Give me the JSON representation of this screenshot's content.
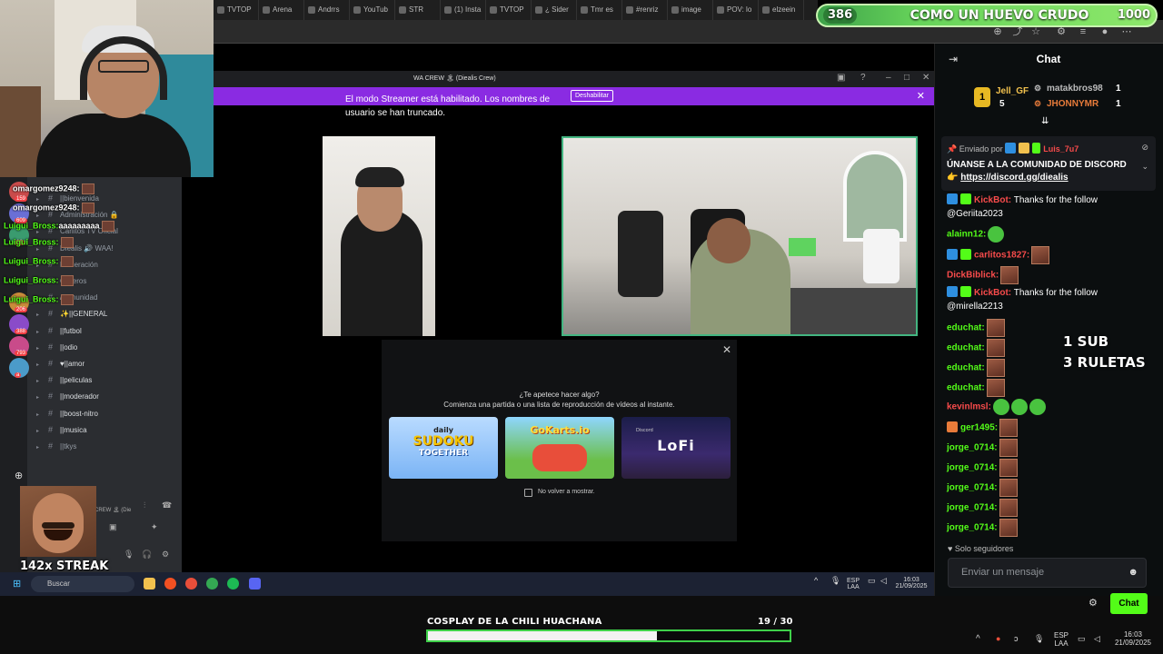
{
  "browser": {
    "tabs": [
      "TVTOP",
      "Arena",
      "Andrrs",
      "YouTub",
      "STR",
      "(1) Insta",
      "TVTOP",
      "¿ Sider",
      "Tmr es",
      "#renriz",
      "image",
      "POV: lo",
      "elzeein"
    ]
  },
  "goal": {
    "current": "386",
    "title": "COMO UN HUEVO CRUDO",
    "target": "1000"
  },
  "discord_overlay": {
    "chat_lines": [
      {
        "user": "omargomez9248:",
        "text": ""
      },
      {
        "user": "omargomez9248:",
        "text": ""
      },
      {
        "user": "Luigui_Bross:",
        "text": "aaaaaaaaa"
      },
      {
        "user": "Luigui_Bross:",
        "text": ""
      },
      {
        "user": "Luigui_Bross:",
        "text": ""
      },
      {
        "user": "Luigui_Bross:",
        "text": ""
      },
      {
        "user": "Luigui_Bross:",
        "text": ""
      }
    ],
    "channels": [
      {
        "label": "||bienvenida"
      },
      {
        "label": "Administración 🔒"
      },
      {
        "label": "Carlitos TV Oficial"
      },
      {
        "label": "Diealis 🔊 WAA!"
      },
      {
        "label": "Moderación"
      },
      {
        "label": "Cliperos"
      },
      {
        "label": "/comunidad"
      },
      {
        "label": "✨||GENERAL"
      },
      {
        "label": "||futbol"
      },
      {
        "label": "||odio"
      },
      {
        "label": "♥||amor"
      },
      {
        "label": "||peliculas"
      },
      {
        "label": "||moderador"
      },
      {
        "label": "||boost-nitro"
      },
      {
        "label": "||musica"
      },
      {
        "label": "||tkys"
      }
    ],
    "server_badges": [
      "159",
      "609",
      "66",
      "206",
      "388",
      "793",
      "a"
    ],
    "voice_label": "CREW 🏝 (Die",
    "streak": "142x STREAK"
  },
  "discord_window": {
    "title": "WA CREW 🏝 (Diealis Crew)",
    "streamer_notice": "El modo Streamer está habilitado. Los nombres de usuario se han truncado.",
    "disable_button": "Deshabilitar",
    "activity": {
      "heading": "¿Te apetece hacer algo?",
      "subheading": "Comienza una partida o una lista de reproducción de vídeos al instante.",
      "cards": [
        {
          "line1": "daily",
          "line2": "SUDOKU",
          "line3": "TOGETHER"
        },
        {
          "line1": "GoKarts.io"
        },
        {
          "line1": "LoFi",
          "sub": "Discord"
        }
      ],
      "checkbox_label": "No volver a mostrar."
    }
  },
  "taskbar_inner": {
    "search_placeholder": "Buscar",
    "lang": "ESP\nLAA",
    "time": "16:03",
    "date": "21/09/2025"
  },
  "bottom": {
    "title": "COSPLAY DE LA CHILI HUACHANA",
    "counter": "19  / 30",
    "progress_fraction": 0.633,
    "lang": "ESP\nLAA",
    "time": "16:03",
    "date": "21/09/2025"
  },
  "chat": {
    "title": "Chat",
    "top_gifters": [
      {
        "name": "Jell_GF",
        "count": "5"
      },
      {
        "name": "matakbros98",
        "count": "1"
      },
      {
        "name": "JHONNYMR",
        "count": "1"
      }
    ],
    "pinned": {
      "sent_by": "Enviado por",
      "user": "Luis_7u7",
      "body": "ÚNANSE A LA COMUNIDAD DE DISCORD 👉",
      "link": "https://discord.gg/diealis"
    },
    "messages": [
      {
        "user": "KickBot:",
        "color": "#f84b4b",
        "text": " Thanks for the follow @Geriita2023",
        "badges": 2
      },
      {
        "user": "alainn12:",
        "color": "#53fc18",
        "text": "",
        "badges": 0
      },
      {
        "user": "carlitos1827:",
        "color": "#f84b4b",
        "text": "",
        "badges": 2
      },
      {
        "user": "DickBiblick:",
        "color": "#f84b4b",
        "text": "",
        "badges": 0
      },
      {
        "user": "KickBot:",
        "color": "#f84b4b",
        "text": " Thanks for the follow @mirella2213",
        "badges": 2
      },
      {
        "user": "educhat:",
        "color": "#53fc18",
        "text": "",
        "badges": 0
      },
      {
        "user": "educhat:",
        "color": "#53fc18",
        "text": "",
        "badges": 0
      },
      {
        "user": "educhat:",
        "color": "#53fc18",
        "text": "",
        "badges": 0
      },
      {
        "user": "educhat:",
        "color": "#53fc18",
        "text": "",
        "badges": 0
      },
      {
        "user": "kevinlmsl:",
        "color": "#f84b4b",
        "text": "",
        "badges": 0
      },
      {
        "user": "ger1495:",
        "color": "#53fc18",
        "text": "",
        "badges": 1
      },
      {
        "user": "jorge_0714:",
        "color": "#53fc18",
        "text": "",
        "badges": 0
      },
      {
        "user": "jorge_0714:",
        "color": "#53fc18",
        "text": "",
        "badges": 0
      },
      {
        "user": "jorge_0714:",
        "color": "#53fc18",
        "text": "",
        "badges": 0
      },
      {
        "user": "jorge_0714:",
        "color": "#53fc18",
        "text": "",
        "badges": 0
      },
      {
        "user": "jorge_0714:",
        "color": "#53fc18",
        "text": "",
        "badges": 0
      }
    ],
    "overlay_line1": "1 SUB",
    "overlay_line2": "3 RULETAS",
    "followers_only": "Solo seguidores",
    "input_placeholder": "Enviar un mensaje",
    "send_label": "Chat"
  },
  "colors": {
    "kick_green": "#53fc18",
    "streamer_purple": "#8a2be2",
    "goal_green": "#67d45a",
    "red_name": "#f84b4b"
  }
}
